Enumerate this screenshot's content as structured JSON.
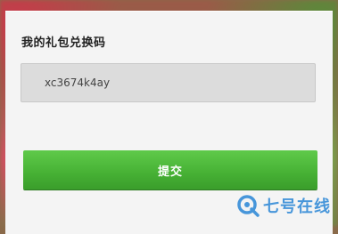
{
  "dialog": {
    "title": "我的礼包兑换码",
    "code_value": "xc3674k4ay",
    "submit_label": "提交"
  },
  "watermark": {
    "text": "七号在线",
    "logo_icon": "q-circle-icon",
    "color": "#2a86d6"
  },
  "colors": {
    "submit_button": "#46b034",
    "dialog_background": "#f4f4f4",
    "field_background": "#dcdcdc"
  }
}
